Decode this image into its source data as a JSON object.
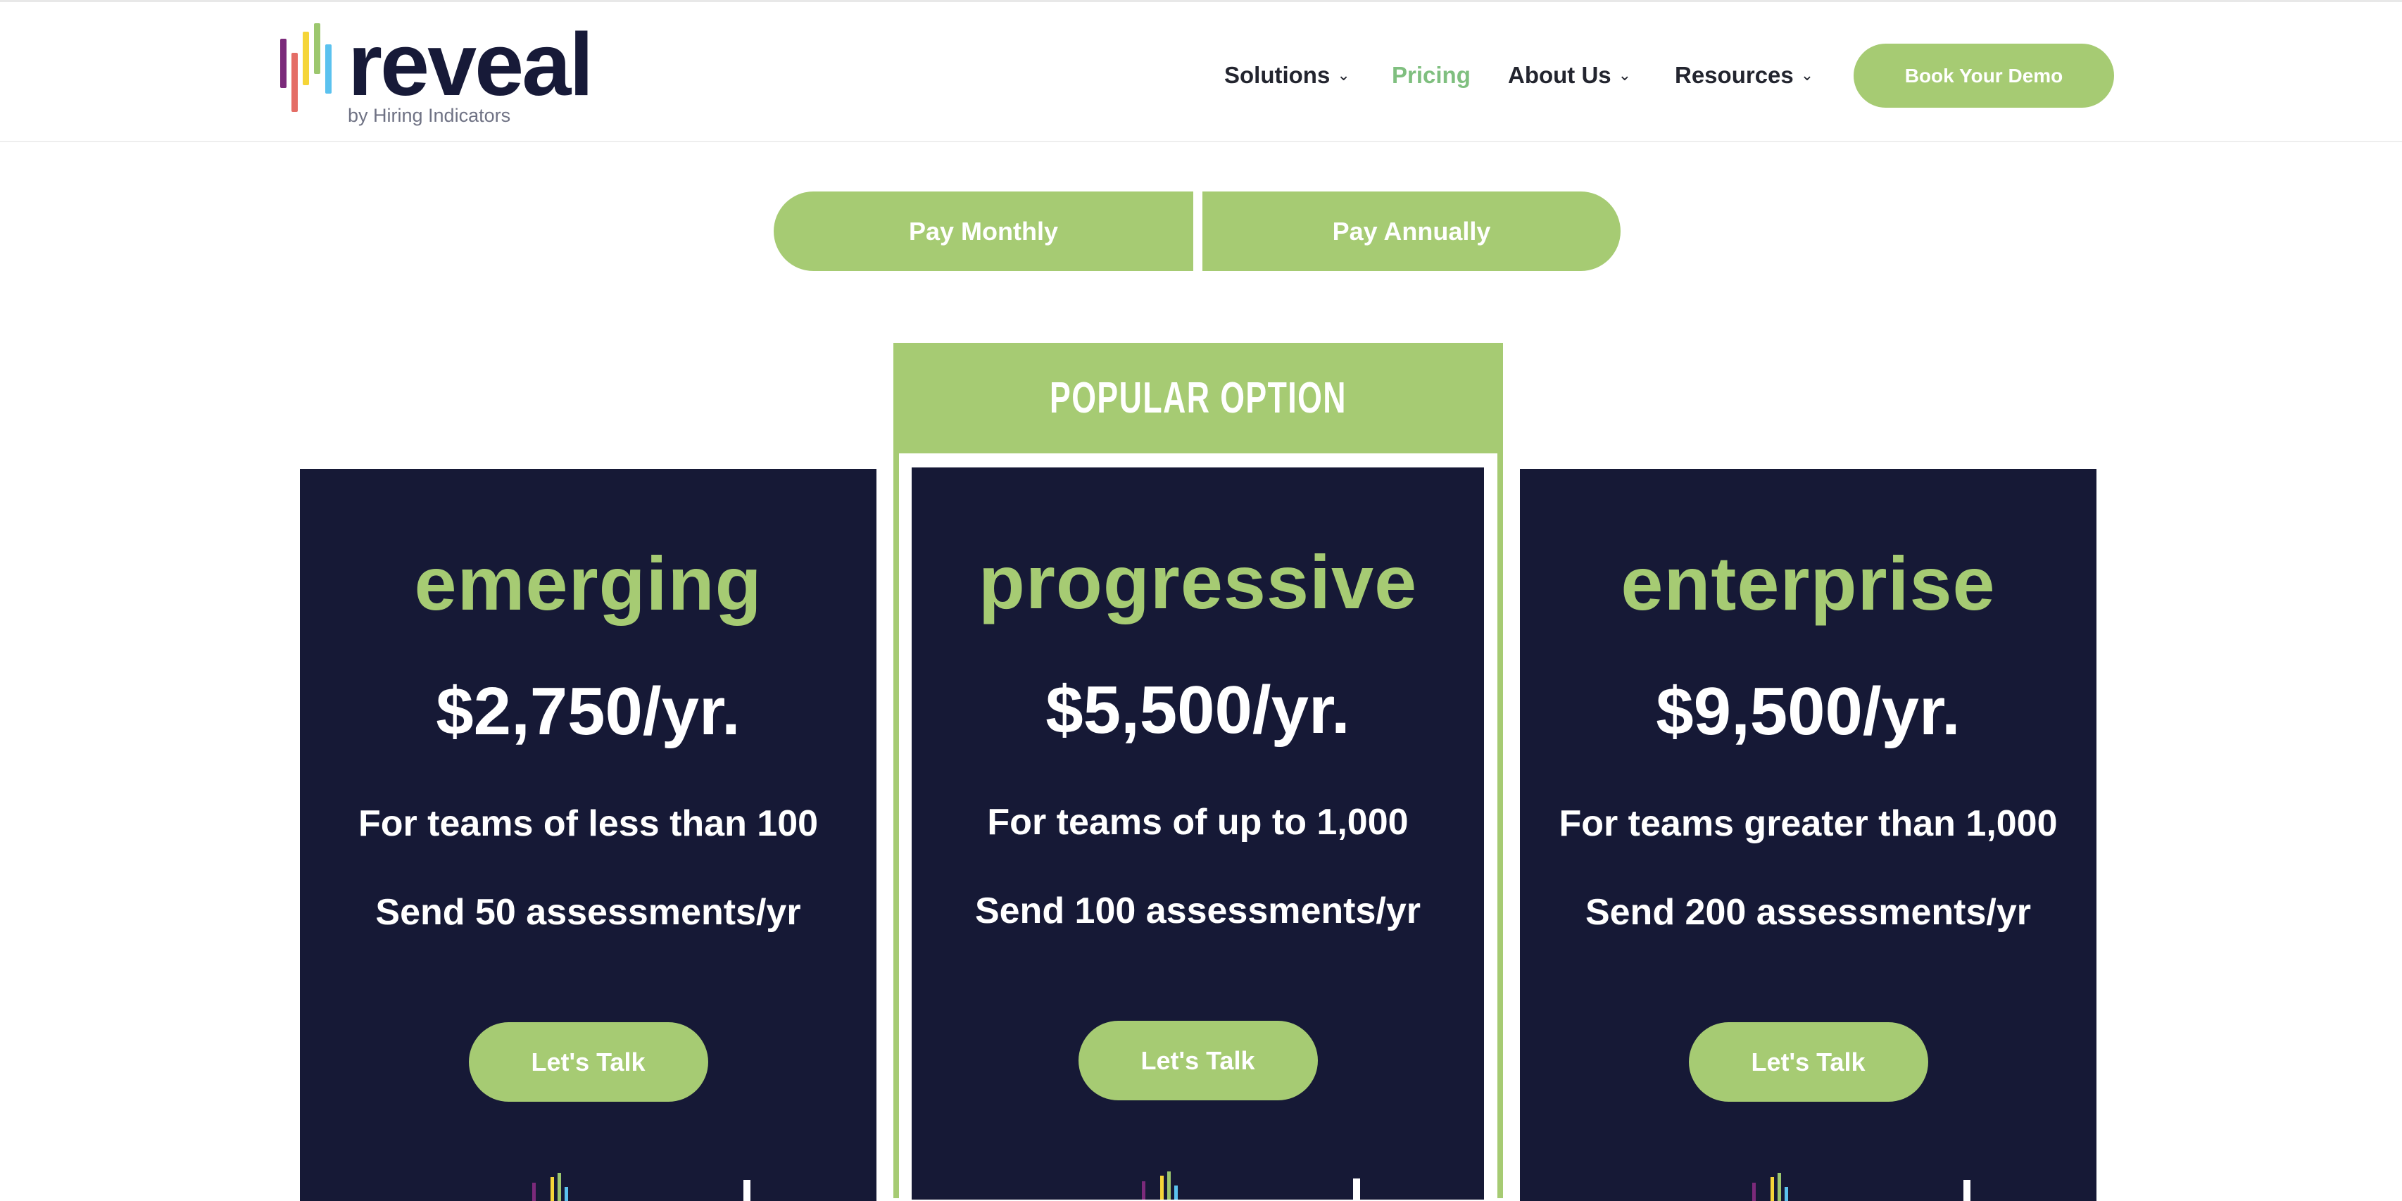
{
  "brand": {
    "name": "reveal",
    "tagline": "by Hiring Indicators",
    "colors": {
      "navy": "#161936",
      "green": "#a6cb73",
      "active": "#7fbf7f"
    }
  },
  "nav": {
    "items": [
      {
        "label": "Solutions",
        "dropdown": true
      },
      {
        "label": "Pricing",
        "active": true
      },
      {
        "label": "About Us",
        "dropdown": true
      },
      {
        "label": "Resources",
        "dropdown": true
      }
    ],
    "cta": "Book Your Demo"
  },
  "billing": {
    "monthly": "Pay Monthly",
    "annually": "Pay Annually"
  },
  "popular_label": "POPULAR OPTION",
  "plans": [
    {
      "name": "emerging",
      "price": "$2,750/yr.",
      "team": "For teams of less than 100",
      "assessments": "Send 50 assessments/yr",
      "cta": "Let's Talk"
    },
    {
      "name": "progressive",
      "price": "$5,500/yr.",
      "team": "For teams of up to 1,000",
      "assessments": "Send 100 assessments/yr",
      "cta": "Let's Talk"
    },
    {
      "name": "enterprise",
      "price": "$9,500/yr.",
      "team": "For teams greater than 1,000",
      "assessments": "Send 200 assessments/yr",
      "cta": "Let's Talk"
    }
  ]
}
